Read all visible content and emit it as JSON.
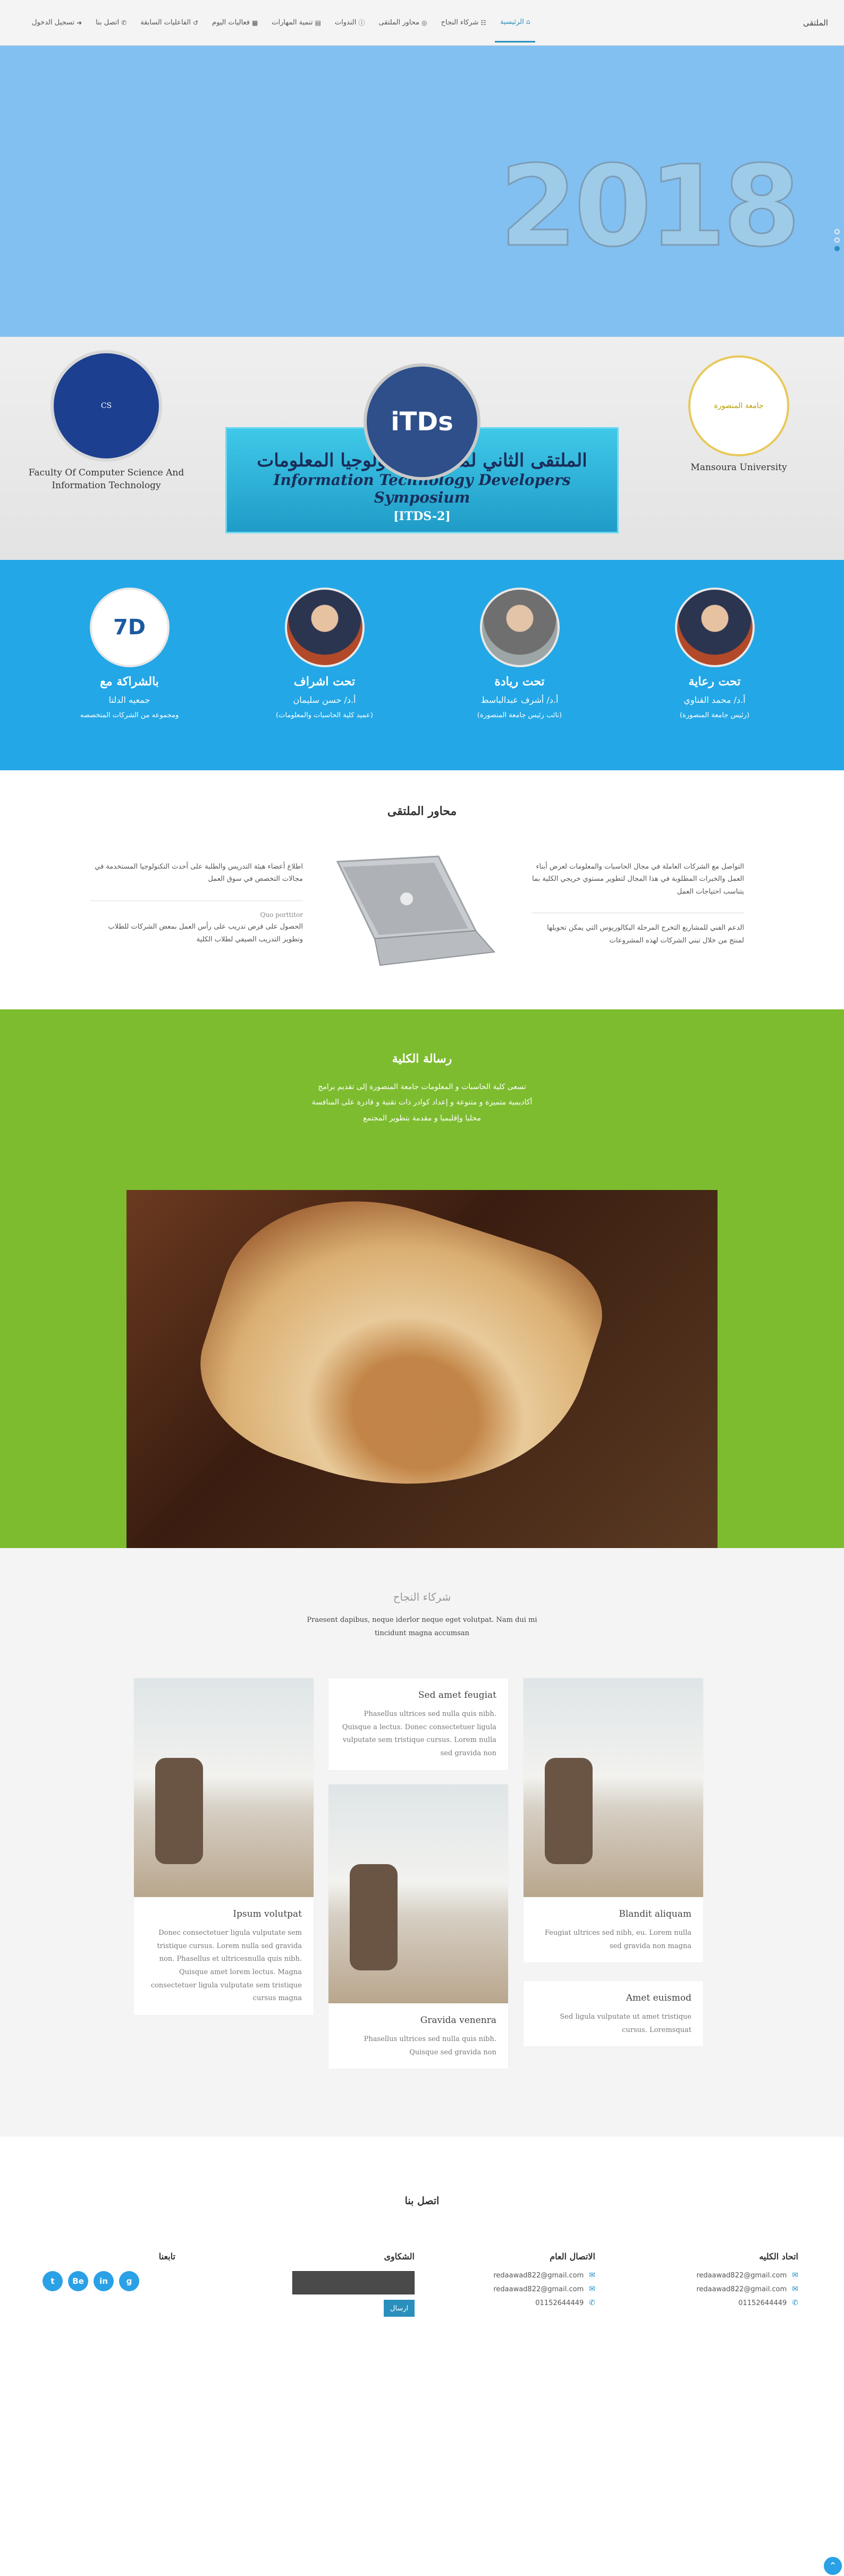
{
  "nav": {
    "brand": "الملتقى",
    "items": [
      {
        "icon": "home-icon",
        "glyph": "⌂",
        "label": "الرئيسية",
        "active": true
      },
      {
        "icon": "users-icon",
        "glyph": "☷",
        "label": "شركاء النجاح"
      },
      {
        "icon": "target-icon",
        "glyph": "◎",
        "label": "محاور الملتقى"
      },
      {
        "icon": "info-icon",
        "glyph": "ⓘ",
        "label": "الندوات"
      },
      {
        "icon": "briefcase-icon",
        "glyph": "▤",
        "label": "تنمية المهارات"
      },
      {
        "icon": "calendar-icon",
        "glyph": "▦",
        "label": "فعاليات اليوم"
      },
      {
        "icon": "history-icon",
        "glyph": "↺",
        "label": "الفاعليات السابقة"
      },
      {
        "icon": "phone-icon",
        "glyph": "✆",
        "label": "اتصل بنا"
      },
      {
        "icon": "login-icon",
        "glyph": "➜",
        "label": "تسجيل الدخول"
      }
    ]
  },
  "hero": {
    "year": "2018"
  },
  "logos": {
    "left_caption": "Faculty Of Computer Science And Information Technology",
    "left_mark": "CS",
    "right_caption": "Mansoura University",
    "right_mark": "جامعة المنصورة",
    "itds_mark": "iTDs",
    "banner_ar": "الملتقى الثاني لمطوري تكنولوجيا المعلومات",
    "banner_en": "Information Technology Developers Symposium",
    "banner_code": "[ITDS-2]"
  },
  "sponsors": [
    {
      "title": "تحت رعاية",
      "name": "أ.د/ محمد القناوي",
      "role": "(رئيس جامعة المنصورة)",
      "avatar": "red"
    },
    {
      "title": "تحت ريادة",
      "name": "أ.د/ أشرف عبدالباسط",
      "role": "(نائب رئيس جامعة المنصورة)",
      "avatar": "gray"
    },
    {
      "title": "تحت اشراف",
      "name": "أ.د/ حسن سليمان",
      "role": "(عميد كلية الحاسبات والمعلومات)",
      "avatar": "red"
    },
    {
      "title": "بالشراكة مع",
      "name": "جمعيه الدلتا",
      "role": "ومجموعه من الشركات المتخصصه",
      "avatar": "delta",
      "avatar_text": "7D"
    }
  ],
  "axes": {
    "title": "محاور الملتقى",
    "right": [
      "التواصل مع الشركات العاملة في مجال الحاسبات والمعلومات لعرض أبناء العمل والخبرات المطلوبة في هذا المجال لتطوير مستوي خريجي الكلية بما يتناسب احتياجات العمل",
      "الدعم الفني للمشاريع التخرج المرحلة البكالوريوس التي يمكن تحويلها لمنتج من خلال تبني الشركات لهذه المشروعات"
    ],
    "left": [
      "اطلاع أعضاء هيئة التدريس والطلبة على أحدث التكنولوجيا المستخدمة في مجالات التخصص في سوق العمل",
      "الحصول على فرص تدريب على رأس العمل بمعض الشركات للطلاب وتطوير التدريب الصيفي لطلاب الكلية"
    ],
    "left_sub": "Quo porttitor"
  },
  "message": {
    "title": "رسالة الكلية",
    "text": "تسعى كلية الحاسبات و المعلومات جامعة المنصورة إلى تقديم برامج أكاديمية متميزة و متنوعة و إعداد كوادر ذات تقنية و قادرة على المنافسة محليا وإقليميا و مقدمة بتطوير المجتمع"
  },
  "partners": {
    "title": "شركاء النجاح",
    "lead": "Praesent dapibus, neque iderlor neque eget volutpat. Nam dui mi tincidunt magna accumsan",
    "cards": [
      {
        "title": "Blandit aliquam",
        "text": "Feugiat ultrices sed nibh, eu. Lorem nulla sed gravida non magna"
      },
      {
        "title": "Sed amet feugiat",
        "text": "Phasellus ultrices sed nulla quis nibh. Quisque a lectus. Donec consectetuer ligula vulputate sem tristique cursus. Lorem nulla sed gravida non"
      },
      {
        "title": "Ipsum volutpat",
        "text": "Donec consectetuer ligula vulputate sem tristique cursus. Lorem nulla sed gravida non. Phasellus et ultricesnulla quis nibh. Quisque amet lorem lectus. Magna consectetuer ligula vulputate sem tristique cursus magna"
      },
      {
        "title": "Gravida venenra",
        "text": "Phasellus ultrices sed nulla quis nibh. Quisque sed gravida non"
      },
      {
        "title": "Amet euismod",
        "text": "Sed ligula vulputate ut amet tristique cursus. Loremsquat"
      }
    ]
  },
  "contact": {
    "title": "اتصل بنا",
    "college": {
      "title": "اتحاد الكليه",
      "lines": [
        {
          "icon": "mail-icon",
          "glyph": "✉",
          "text": "redaawad822@gmail.com"
        },
        {
          "icon": "mail-icon",
          "glyph": "✉",
          "text": "redaawad822@gmail.com"
        },
        {
          "icon": "phone-icon",
          "glyph": "✆",
          "text": "01152644449"
        }
      ]
    },
    "general": {
      "title": "الاتصال العام",
      "lines": [
        {
          "icon": "mail-icon",
          "glyph": "✉",
          "text": "redaawad822@gmail.com"
        },
        {
          "icon": "mail-icon",
          "glyph": "✉",
          "text": "redaawad822@gmail.com"
        },
        {
          "icon": "phone-icon",
          "glyph": "✆",
          "text": "01152644449"
        }
      ]
    },
    "complaints": {
      "title": "الشكاوى",
      "send": "ارسال"
    },
    "follow": {
      "title": "تابعنا",
      "socials": [
        {
          "icon": "twitter-icon",
          "glyph": "t"
        },
        {
          "icon": "bebo-icon",
          "glyph": "Be"
        },
        {
          "icon": "linkedin-icon",
          "glyph": "in"
        },
        {
          "icon": "google-plus-icon",
          "glyph": "g"
        }
      ]
    }
  }
}
